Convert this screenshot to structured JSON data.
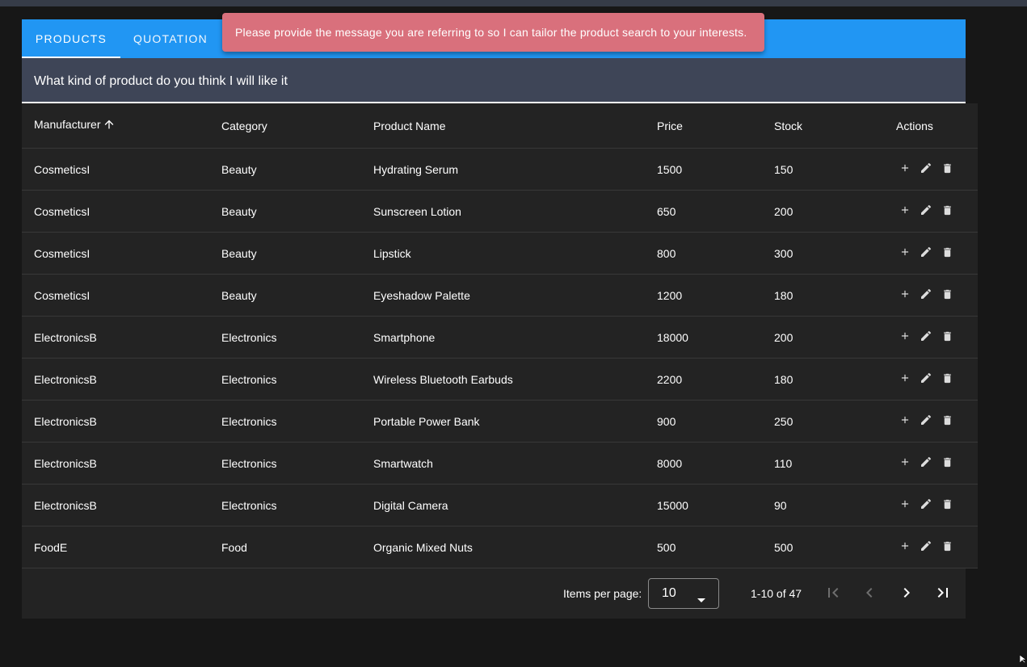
{
  "tabs": [
    {
      "label": "PRODUCTS",
      "active": true
    },
    {
      "label": "QUOTATION",
      "active": false
    }
  ],
  "toast": {
    "message": "Please provide the message you are referring to so I can tailor the product search to your interests."
  },
  "search": {
    "value": "What kind of product do you think I will like it"
  },
  "table": {
    "headers": {
      "manufacturer": "Manufacturer",
      "category": "Category",
      "product_name": "Product Name",
      "price": "Price",
      "stock": "Stock",
      "actions": "Actions"
    },
    "rows": [
      {
        "manufacturer": "CosmeticsI",
        "category": "Beauty",
        "product_name": "Hydrating Serum",
        "price": "1500",
        "stock": "150"
      },
      {
        "manufacturer": "CosmeticsI",
        "category": "Beauty",
        "product_name": "Sunscreen Lotion",
        "price": "650",
        "stock": "200"
      },
      {
        "manufacturer": "CosmeticsI",
        "category": "Beauty",
        "product_name": "Lipstick",
        "price": "800",
        "stock": "300"
      },
      {
        "manufacturer": "CosmeticsI",
        "category": "Beauty",
        "product_name": "Eyeshadow Palette",
        "price": "1200",
        "stock": "180"
      },
      {
        "manufacturer": "ElectronicsB",
        "category": "Electronics",
        "product_name": "Smartphone",
        "price": "18000",
        "stock": "200"
      },
      {
        "manufacturer": "ElectronicsB",
        "category": "Electronics",
        "product_name": "Wireless Bluetooth Earbuds",
        "price": "2200",
        "stock": "180"
      },
      {
        "manufacturer": "ElectronicsB",
        "category": "Electronics",
        "product_name": "Portable Power Bank",
        "price": "900",
        "stock": "250"
      },
      {
        "manufacturer": "ElectronicsB",
        "category": "Electronics",
        "product_name": "Smartwatch",
        "price": "8000",
        "stock": "110"
      },
      {
        "manufacturer": "ElectronicsB",
        "category": "Electronics",
        "product_name": "Digital Camera",
        "price": "15000",
        "stock": "90"
      },
      {
        "manufacturer": "FoodE",
        "category": "Food",
        "product_name": "Organic Mixed Nuts",
        "price": "500",
        "stock": "500"
      }
    ]
  },
  "paginator": {
    "items_per_page_label": "Items per page:",
    "items_per_page_value": "10",
    "range_label": "1-10 of 47"
  },
  "colors": {
    "tab_bar": "#2196f3",
    "toast": "#d9707c",
    "search_bg": "#3e4557",
    "table_bg": "#232323",
    "page_bg": "#171717"
  },
  "icons": {
    "sort": "arrow-up-icon",
    "row_actions": [
      "plus-icon",
      "pencil-icon",
      "trash-icon"
    ],
    "select": "caret-down-icon",
    "pagination": [
      "first-page-icon",
      "chevron-left-icon",
      "chevron-right-icon",
      "last-page-icon"
    ]
  }
}
